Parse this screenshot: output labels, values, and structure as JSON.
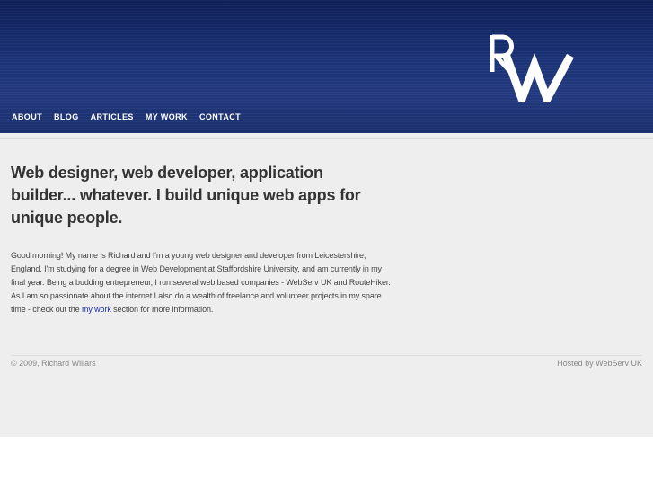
{
  "header": {
    "logo_text": "RW",
    "nav": [
      {
        "label": "ABOUT"
      },
      {
        "label": "BLOG"
      },
      {
        "label": "ARTICLES"
      },
      {
        "label": "MY WORK"
      },
      {
        "label": "CONTACT"
      }
    ]
  },
  "main": {
    "headline": "Web designer, web developer, application builder... whatever. I build unique web apps for unique people.",
    "intro_before_link": "Good morning! My name is Richard and I'm a young web designer and developer from Leicestershire, England. I'm studying for a degree in Web Development at Staffordshire University, and am currently in my final year. Being a budding entrepreneur, I run several web based companies - WebServ UK and RouteHiker. As I am so passionate about the internet I also do a wealth of freelance and volunteer projects in my spare time - check out the ",
    "intro_link": "my work",
    "intro_after_link": " section for more information."
  },
  "footer": {
    "copyright": "© 2009, Richard Willars",
    "hosted": "Hosted by WebServ UK"
  },
  "colors": {
    "header_dark": "#0e1f57",
    "header_mid": "#22397f",
    "content_bg": "#eeeeee",
    "link": "#1a2fb8"
  }
}
